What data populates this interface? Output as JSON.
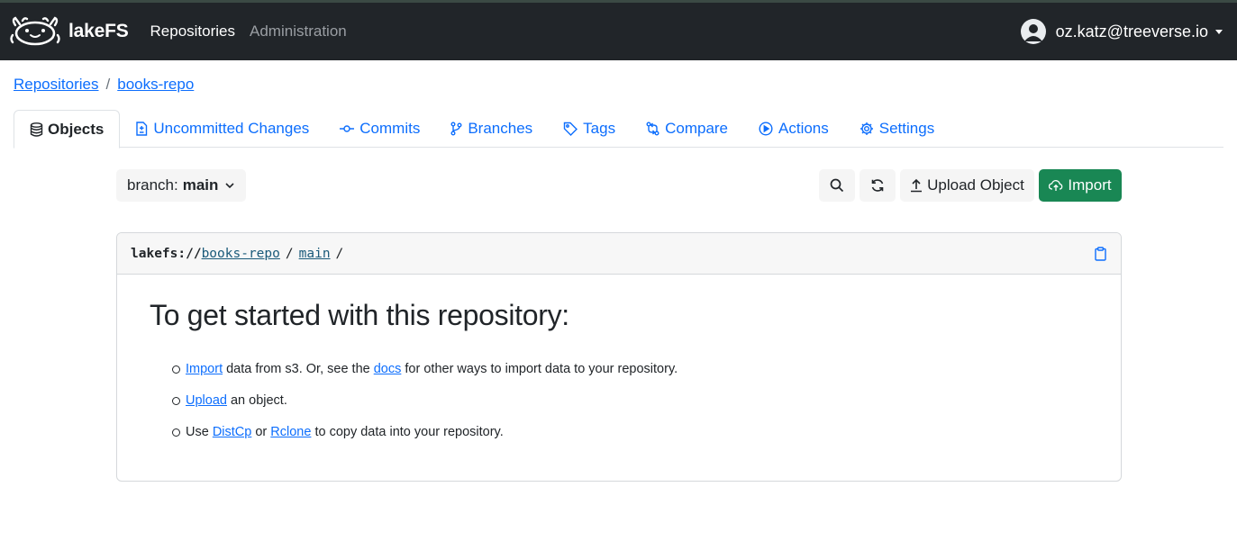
{
  "navbar": {
    "brand": "lakeFS",
    "links": [
      "Repositories",
      "Administration"
    ],
    "user_email": "oz.katz@treeverse.io"
  },
  "breadcrumb": {
    "root": "Repositories",
    "separator": "/",
    "repo": "books-repo"
  },
  "tabs": [
    {
      "label": "Objects",
      "icon": "database-icon",
      "active": true
    },
    {
      "label": "Uncommitted Changes",
      "icon": "file-diff-icon"
    },
    {
      "label": "Commits",
      "icon": "git-commit-icon"
    },
    {
      "label": "Branches",
      "icon": "git-branch-icon"
    },
    {
      "label": "Tags",
      "icon": "tag-icon"
    },
    {
      "label": "Compare",
      "icon": "git-compare-icon"
    },
    {
      "label": "Actions",
      "icon": "play-icon"
    },
    {
      "label": "Settings",
      "icon": "gear-icon"
    }
  ],
  "toolbar": {
    "branch_prefix": "branch:",
    "branch_name": "main",
    "upload_label": "Upload Object",
    "import_label": "Import"
  },
  "path": {
    "protocol": "lakefs://",
    "repo": "books-repo",
    "ref": "main",
    "separator": "/"
  },
  "getting_started": {
    "title": "To get started with this repository:",
    "item1": {
      "link": "Import",
      "text1": " data from s3. Or, see the ",
      "link2": "docs",
      "text2": " for other ways to import data to your repository."
    },
    "item2": {
      "link": "Upload",
      "text1": " an object."
    },
    "item3": {
      "text0": "Use ",
      "link": "DistCp",
      "text1": " or ",
      "link2": "Rclone",
      "text2": " to copy data into your repository."
    }
  },
  "colors": {
    "navbar_bg": "#212529",
    "link": "#0d6efd",
    "import_button": "#198754"
  }
}
